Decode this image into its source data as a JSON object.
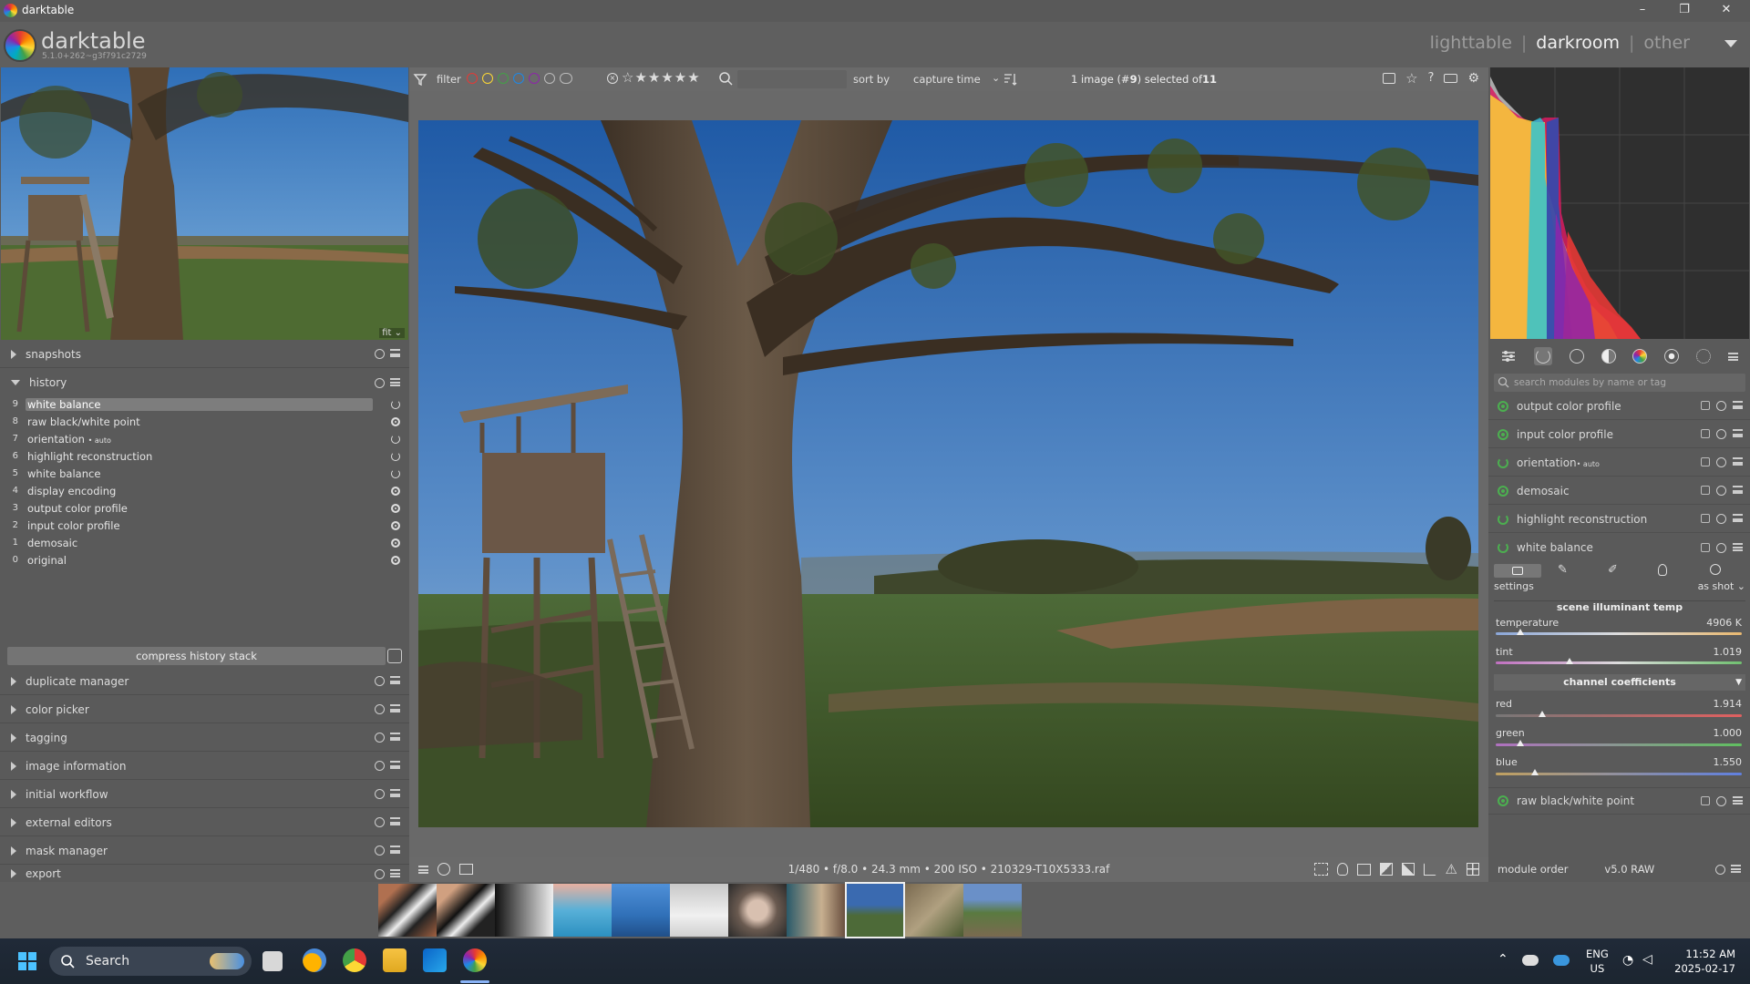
{
  "window": {
    "title": "darktable",
    "minimize": "–",
    "maximize": "❐",
    "close": "✕"
  },
  "header": {
    "app_name": "darktable",
    "version": "5.1.0+262~g3f791c2729",
    "views": [
      "lighttable",
      "darkroom",
      "other"
    ],
    "active_view": "darkroom",
    "separator": "|"
  },
  "navigation": {
    "zoom": "fit ⌄"
  },
  "left_panel": {
    "snapshots": "snapshots",
    "history": "history",
    "history_items": [
      {
        "num": "9",
        "name": "white balance",
        "status": "power",
        "selected": true
      },
      {
        "num": "8",
        "name": "raw black/white point",
        "status": "on"
      },
      {
        "num": "7",
        "name": "orientation",
        "suffix": "• auto",
        "status": "power"
      },
      {
        "num": "6",
        "name": "highlight reconstruction",
        "status": "power"
      },
      {
        "num": "5",
        "name": "white balance",
        "status": "power"
      },
      {
        "num": "4",
        "name": "display encoding",
        "status": "on"
      },
      {
        "num": "3",
        "name": "output color profile",
        "status": "on"
      },
      {
        "num": "2",
        "name": "input color profile",
        "status": "on"
      },
      {
        "num": "1",
        "name": "demosaic",
        "status": "on"
      },
      {
        "num": "0",
        "name": "original",
        "status": "on"
      }
    ],
    "compress_button": "compress history stack",
    "sections": [
      "duplicate manager",
      "color picker",
      "tagging",
      "image information",
      "initial workflow",
      "external editors",
      "mask manager",
      "export"
    ]
  },
  "top_toolbar": {
    "filter_label": "filter",
    "sort_by_label": "sort by",
    "sort_value": "capture time",
    "selection_text_pre": "1 image (#",
    "selection_num": "9",
    "selection_text_post": ") selected of ",
    "selection_total": "11",
    "color_labels": [
      "#e53935",
      "#fdd835",
      "#43a047",
      "#1e88e5",
      "#8e24aa"
    ],
    "stars": "☆★★★★★"
  },
  "image_info": "1/480 • f/8.0 • 24.3 mm • 200 ISO • 210329-T10X5333.raf",
  "right_panel": {
    "search_placeholder": "search modules by name or tag",
    "modules": [
      {
        "name": "output color profile",
        "on": true
      },
      {
        "name": "input color profile",
        "on": true
      },
      {
        "name": "orientation",
        "suffix": "• auto",
        "on": false
      },
      {
        "name": "demosaic",
        "on": true
      },
      {
        "name": "highlight reconstruction",
        "on": false
      },
      {
        "name": "white balance",
        "on": false
      }
    ],
    "white_balance": {
      "settings_label": "settings",
      "preset": "as shot ⌄",
      "scene_header": "scene illuminant temp",
      "temperature_label": "temperature",
      "temperature_value": "4906 K",
      "temperature_pos": 0.1,
      "tint_label": "tint",
      "tint_value": "1.019",
      "tint_pos": 0.3,
      "channel_header": "channel coefficients",
      "channel_toggle": "▼",
      "red_label": "red",
      "red_value": "1.914",
      "red_pos": 0.19,
      "green_label": "green",
      "green_value": "1.000",
      "green_pos": 0.1,
      "blue_label": "blue",
      "blue_value": "1.550",
      "blue_pos": 0.16
    },
    "raw_module": "raw black/white point",
    "module_order_label": "module order",
    "module_order_value": "v5.0 RAW"
  },
  "taskbar": {
    "search": "Search",
    "lang": "ENG",
    "region": "US",
    "time": "11:52 AM",
    "date": "2025-02-17"
  }
}
